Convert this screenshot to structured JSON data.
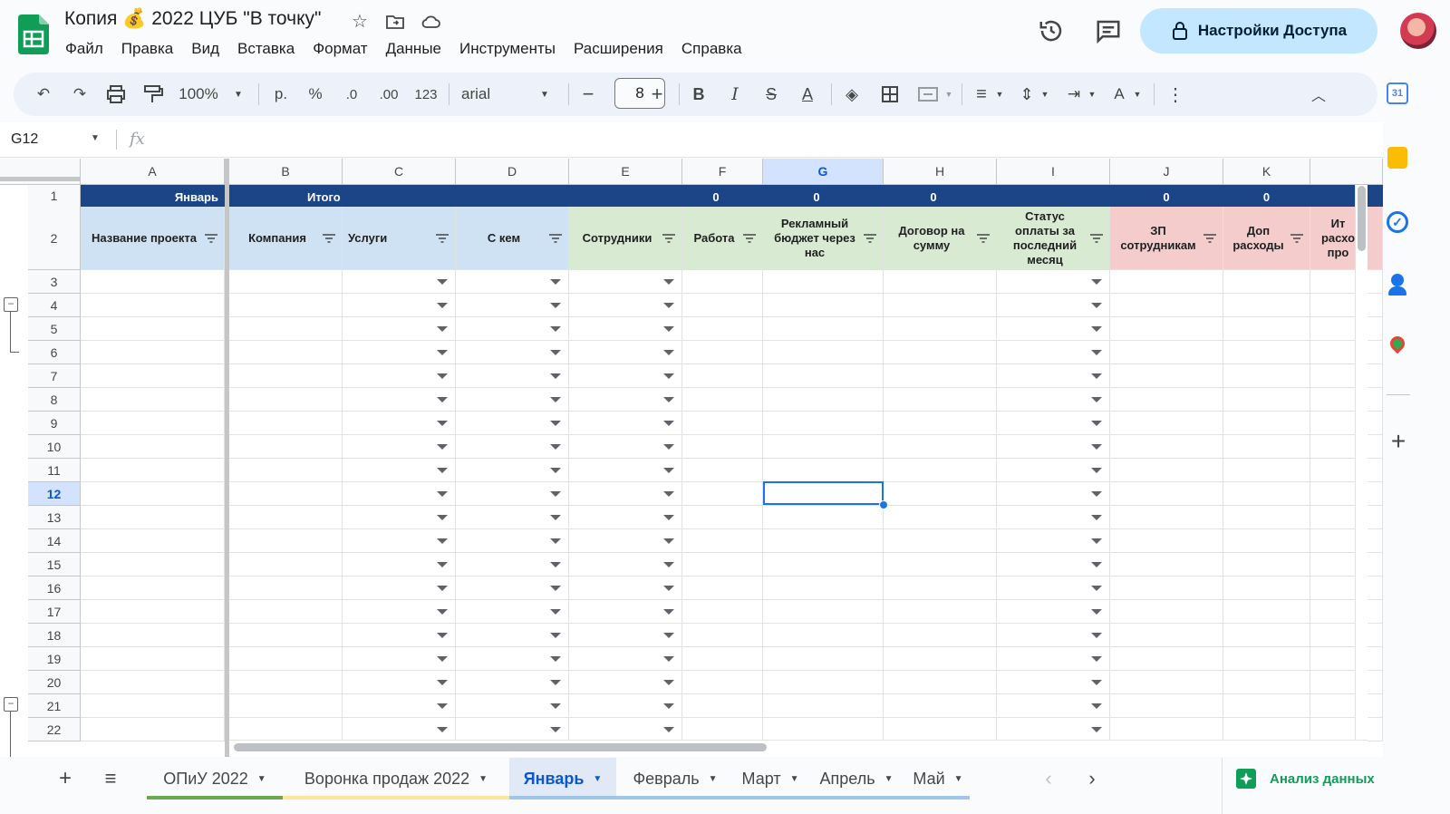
{
  "document": {
    "title": "Копия 💰 2022 ЦУБ \"В точку\"",
    "menu": [
      "Файл",
      "Правка",
      "Вид",
      "Вставка",
      "Формат",
      "Данные",
      "Инструменты",
      "Расширения",
      "Справка"
    ],
    "share_label": "Настройки Доступа"
  },
  "toolbar": {
    "zoom": "100%",
    "currency": "р.",
    "percent": "%",
    "decrease_decimal": ".0",
    "increase_decimal": ".00",
    "number_format": "123",
    "font": "arial",
    "font_size": "8"
  },
  "formula_bar": {
    "name_box": "G12",
    "fx": "fx"
  },
  "grid": {
    "columns": [
      "A",
      "B",
      "C",
      "D",
      "E",
      "F",
      "G",
      "H",
      "I",
      "J",
      "K",
      ""
    ],
    "selected_column": "G",
    "selected_row": "12",
    "row1": {
      "A": "Январь",
      "B": "Итого",
      "F": "0",
      "G": "0",
      "H": "0",
      "J": "0",
      "K": "0"
    },
    "headers": {
      "A": "Название проекта",
      "B": "Компания",
      "C": "Услуги",
      "D": "С кем",
      "E": "Сотрудники",
      "F": "Работа",
      "G": "Рекламный бюджет через нас",
      "H": "Договор на сумму",
      "I": "Статус оплаты за последний месяц",
      "J": "ЗП сотрудникам",
      "K": "Доп расходы",
      "L": "Ит расхо про"
    },
    "row_numbers": [
      "1",
      "2",
      "3",
      "4",
      "5",
      "6",
      "7",
      "8",
      "9",
      "10",
      "11",
      "12",
      "13",
      "14",
      "15",
      "16",
      "17",
      "18",
      "19",
      "20",
      "21",
      "22"
    ],
    "colors": {
      "row1_bg": "#1c4587",
      "header_blue": "#cfe2f3",
      "header_green": "#d9ead3",
      "header_red": "#f4cccc",
      "selection": "#1a73e8"
    }
  },
  "sheets": {
    "tabs": [
      {
        "name": "ОПиУ 2022",
        "color": "#6aa84f"
      },
      {
        "name": "Воронка продаж 2022",
        "color": "#ffe599"
      },
      {
        "name": "Январь",
        "color": "#9fc5e8",
        "active": true
      },
      {
        "name": "Февраль",
        "color": "#9fc5e8"
      },
      {
        "name": "Март",
        "color": "#9fc5e8"
      },
      {
        "name": "Апрель",
        "color": "#9fc5e8"
      },
      {
        "name": "Май",
        "color": "#9fc5e8"
      }
    ],
    "explore_label": "Анализ данных"
  }
}
